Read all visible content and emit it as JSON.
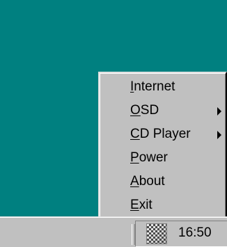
{
  "desktop": {
    "background_color": "#008080"
  },
  "menu": {
    "items": [
      {
        "accel": "I",
        "rest": "nternet",
        "has_submenu": false
      },
      {
        "accel": "O",
        "rest": "SD",
        "has_submenu": true
      },
      {
        "accel": "C",
        "rest": "D Player",
        "has_submenu": true
      },
      {
        "accel": "P",
        "rest": "ower",
        "has_submenu": false
      },
      {
        "accel": "A",
        "rest": "bout",
        "has_submenu": false
      },
      {
        "accel": "E",
        "rest": "xit",
        "has_submenu": false
      }
    ]
  },
  "tray": {
    "icon": "display-settings-icon",
    "clock": "16:50"
  }
}
